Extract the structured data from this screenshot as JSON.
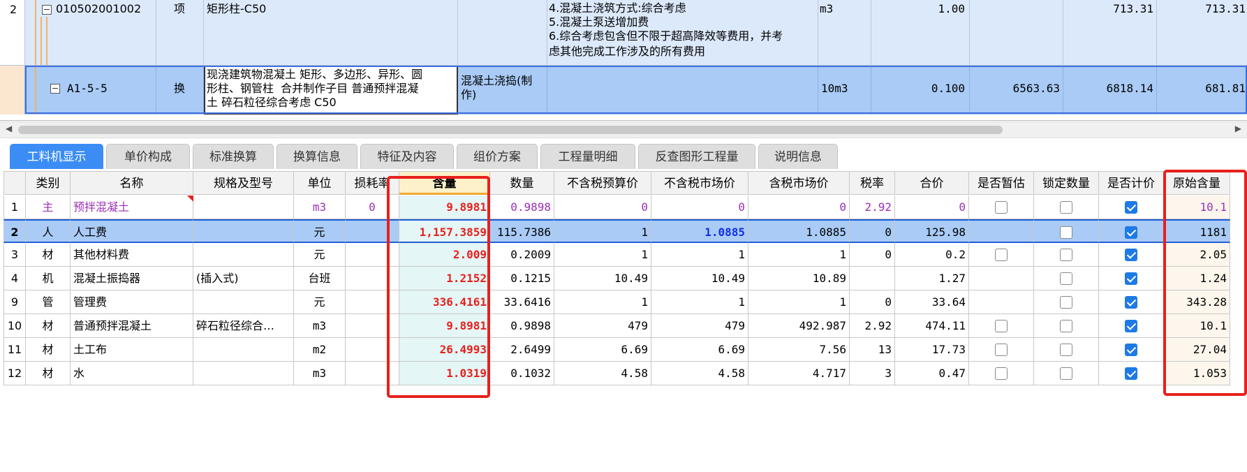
{
  "top_grid": {
    "row1": {
      "num": "2",
      "code": "010502001002",
      "type": "项",
      "name": "矩形柱-C50",
      "features": [
        "4.混凝土浇筑方式:综合考虑",
        "5.混凝土泵送增加费",
        "6.综合考虑包含但不限于超高降效等费用，并考",
        "虑其他完成工作涉及的所有费用"
      ],
      "unit": "m3",
      "quantity": "1.00",
      "unit_price": "713.31",
      "total": "713.31"
    },
    "row2": {
      "code": "A1-5-5",
      "type": "换",
      "name": [
        "现浇建筑物混凝土 矩形、多边形、异形、圆",
        "形柱、钢管柱  合并制作子目 普通预拌混凝",
        "土 碎石粒径综合考虑 C50"
      ],
      "spec": [
        "混凝土浇捣(制",
        "作)"
      ],
      "unit": "10m3",
      "quantity": "0.100",
      "budget_price": "6563.63",
      "unit_price": "6818.14",
      "total": "681.81"
    }
  },
  "tabs": [
    "工料机显示",
    "单价构成",
    "标准换算",
    "换算信息",
    "特征及内容",
    "组价方案",
    "工程量明细",
    "反查图形工程量",
    "说明信息"
  ],
  "table": {
    "headers": [
      "类别",
      "名称",
      "规格及型号",
      "单位",
      "损耗率",
      "含量",
      "数量",
      "不含税预算价",
      "不含税市场价",
      "含税市场价",
      "税率",
      "合价",
      "是否暂估",
      "锁定数量",
      "是否计价",
      "原始含量"
    ],
    "rows": [
      {
        "num": "1",
        "cat": "主",
        "name": "预拌混凝土",
        "spec": "",
        "unit": "m3",
        "loss": "0",
        "content": "9.8981",
        "qty": "0.9898",
        "budget": "0",
        "market": "0",
        "taxmarket": "0",
        "rate": "2.92",
        "total": "0",
        "est": false,
        "lock": false,
        "priced": true,
        "orig": "10.1"
      },
      {
        "num": "2",
        "cat": "人",
        "name": "人工费",
        "spec": "",
        "unit": "元",
        "loss": "",
        "content": "1,157.3859",
        "qty": "115.7386",
        "budget": "1",
        "market": "1.0885",
        "taxmarket": "1.0885",
        "rate": "0",
        "total": "125.98",
        "est": null,
        "lock": false,
        "priced": true,
        "orig": "1181"
      },
      {
        "num": "3",
        "cat": "材",
        "name": "其他材料费",
        "spec": "",
        "unit": "元",
        "loss": "",
        "content": "2.009",
        "qty": "0.2009",
        "budget": "1",
        "market": "1",
        "taxmarket": "1",
        "rate": "0",
        "total": "0.2",
        "est": false,
        "lock": false,
        "priced": true,
        "orig": "2.05"
      },
      {
        "num": "4",
        "cat": "机",
        "name": "混凝土振捣器",
        "spec": "(插入式)",
        "unit": "台班",
        "loss": "",
        "content": "1.2152",
        "qty": "0.1215",
        "budget": "10.49",
        "market": "10.49",
        "taxmarket": "10.89",
        "rate": "",
        "total": "1.27",
        "est": null,
        "lock": false,
        "priced": true,
        "orig": "1.24"
      },
      {
        "num": "9",
        "cat": "管",
        "name": "管理费",
        "spec": "",
        "unit": "元",
        "loss": "",
        "content": "336.4161",
        "qty": "33.6416",
        "budget": "1",
        "market": "1",
        "taxmarket": "1",
        "rate": "0",
        "total": "33.64",
        "est": null,
        "lock": false,
        "priced": true,
        "orig": "343.28"
      },
      {
        "num": "10",
        "cat": "材",
        "name": "普通预拌混凝土",
        "spec": "碎石粒径综合…",
        "unit": "m3",
        "loss": "",
        "content": "9.8981",
        "qty": "0.9898",
        "budget": "479",
        "market": "479",
        "taxmarket": "492.987",
        "rate": "2.92",
        "total": "474.11",
        "est": false,
        "lock": false,
        "priced": true,
        "orig": "10.1"
      },
      {
        "num": "11",
        "cat": "材",
        "name": "土工布",
        "spec": "",
        "unit": "m2",
        "loss": "",
        "content": "26.4993",
        "qty": "2.6499",
        "budget": "6.69",
        "market": "6.69",
        "taxmarket": "7.56",
        "rate": "13",
        "total": "17.73",
        "est": false,
        "lock": false,
        "priced": true,
        "orig": "27.04"
      },
      {
        "num": "12",
        "cat": "材",
        "name": "水",
        "spec": "",
        "unit": "m3",
        "loss": "",
        "content": "1.0319",
        "qty": "0.1032",
        "budget": "4.58",
        "market": "4.58",
        "taxmarket": "4.717",
        "rate": "3",
        "total": "0.47",
        "est": false,
        "lock": false,
        "priced": true,
        "orig": "1.053"
      }
    ]
  },
  "colors": {
    "accent": "#3b8df5",
    "highlight": "#e8201c",
    "selected_row": "#a9cbf6",
    "purple": "#9b2fb5",
    "content_red": "#e8201c"
  }
}
